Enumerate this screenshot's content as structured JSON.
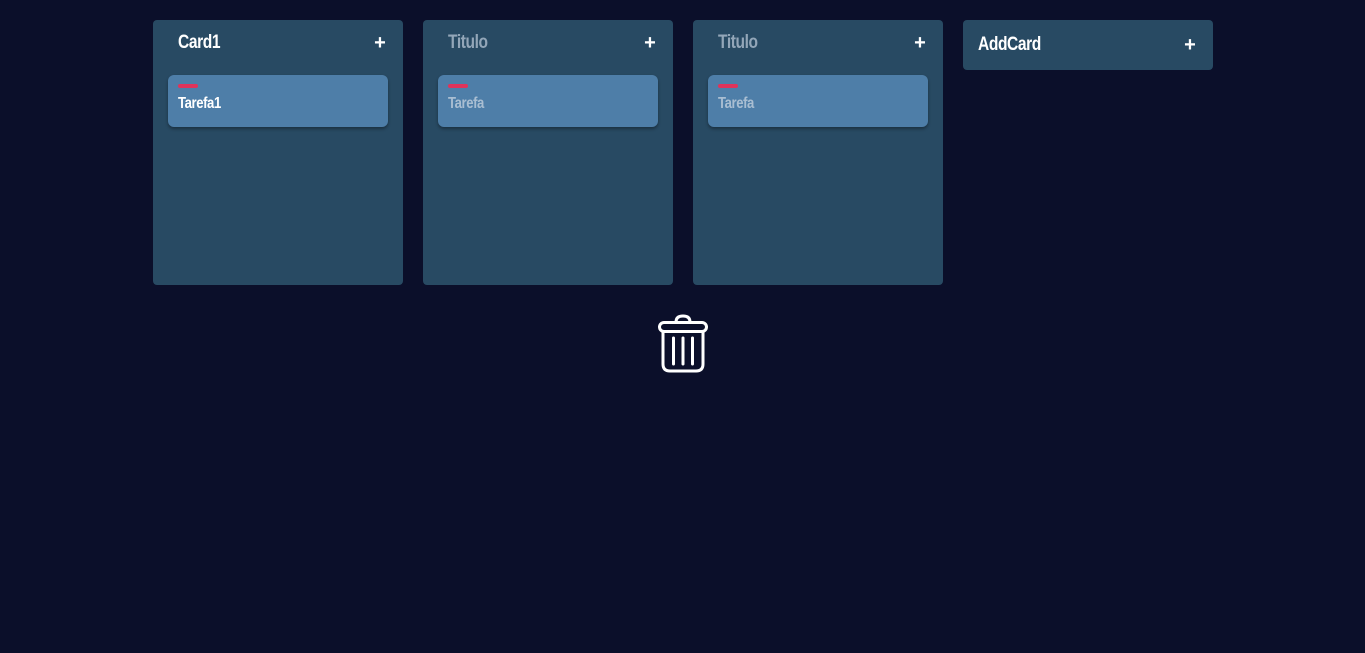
{
  "colors": {
    "background": "#0b0f2a",
    "column": "#284a63",
    "task": "#4e7ea8",
    "tag": "#e0335a",
    "placeholder_title": "#93a6b8",
    "placeholder_task": "#a9bed2"
  },
  "columns": [
    {
      "title": "Card1",
      "add_label": "+",
      "tasks": [
        {
          "text": "Tarefa1"
        }
      ]
    },
    {
      "title": "Titulo",
      "add_label": "+",
      "tasks": [
        {
          "text": "Tarefa"
        }
      ]
    },
    {
      "title": "Titulo",
      "add_label": "+",
      "tasks": [
        {
          "text": "Tarefa"
        }
      ]
    }
  ],
  "add_card": {
    "label": "AddCard",
    "add_label": "+"
  },
  "trash": {
    "icon": "trash-icon"
  }
}
